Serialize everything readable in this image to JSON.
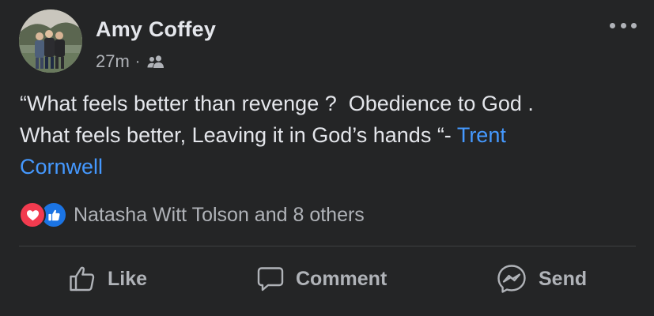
{
  "post": {
    "author": "Amy Coffey",
    "time": "27m",
    "separator": "·",
    "audience_icon": "friends-icon",
    "more_icon": "more-horizontal-icon",
    "text_before_link": "“What feels better than revenge ?  Obedience to God .\nWhat feels better, Leaving it in God’s hands “- ",
    "mention": "Trent\nCornwell",
    "colors": {
      "background": "#242526",
      "text": "#e4e6eb",
      "secondary_text": "#b0b3b8",
      "link": "#4599ff",
      "love": "#f23b4f",
      "like": "#1b74e4"
    }
  },
  "reactions": {
    "icons": [
      "love-reaction-icon",
      "like-reaction-icon"
    ],
    "summary": "Natasha Witt Tolson and 8 others"
  },
  "actions": {
    "like_label": "Like",
    "comment_label": "Comment",
    "send_label": "Send"
  }
}
